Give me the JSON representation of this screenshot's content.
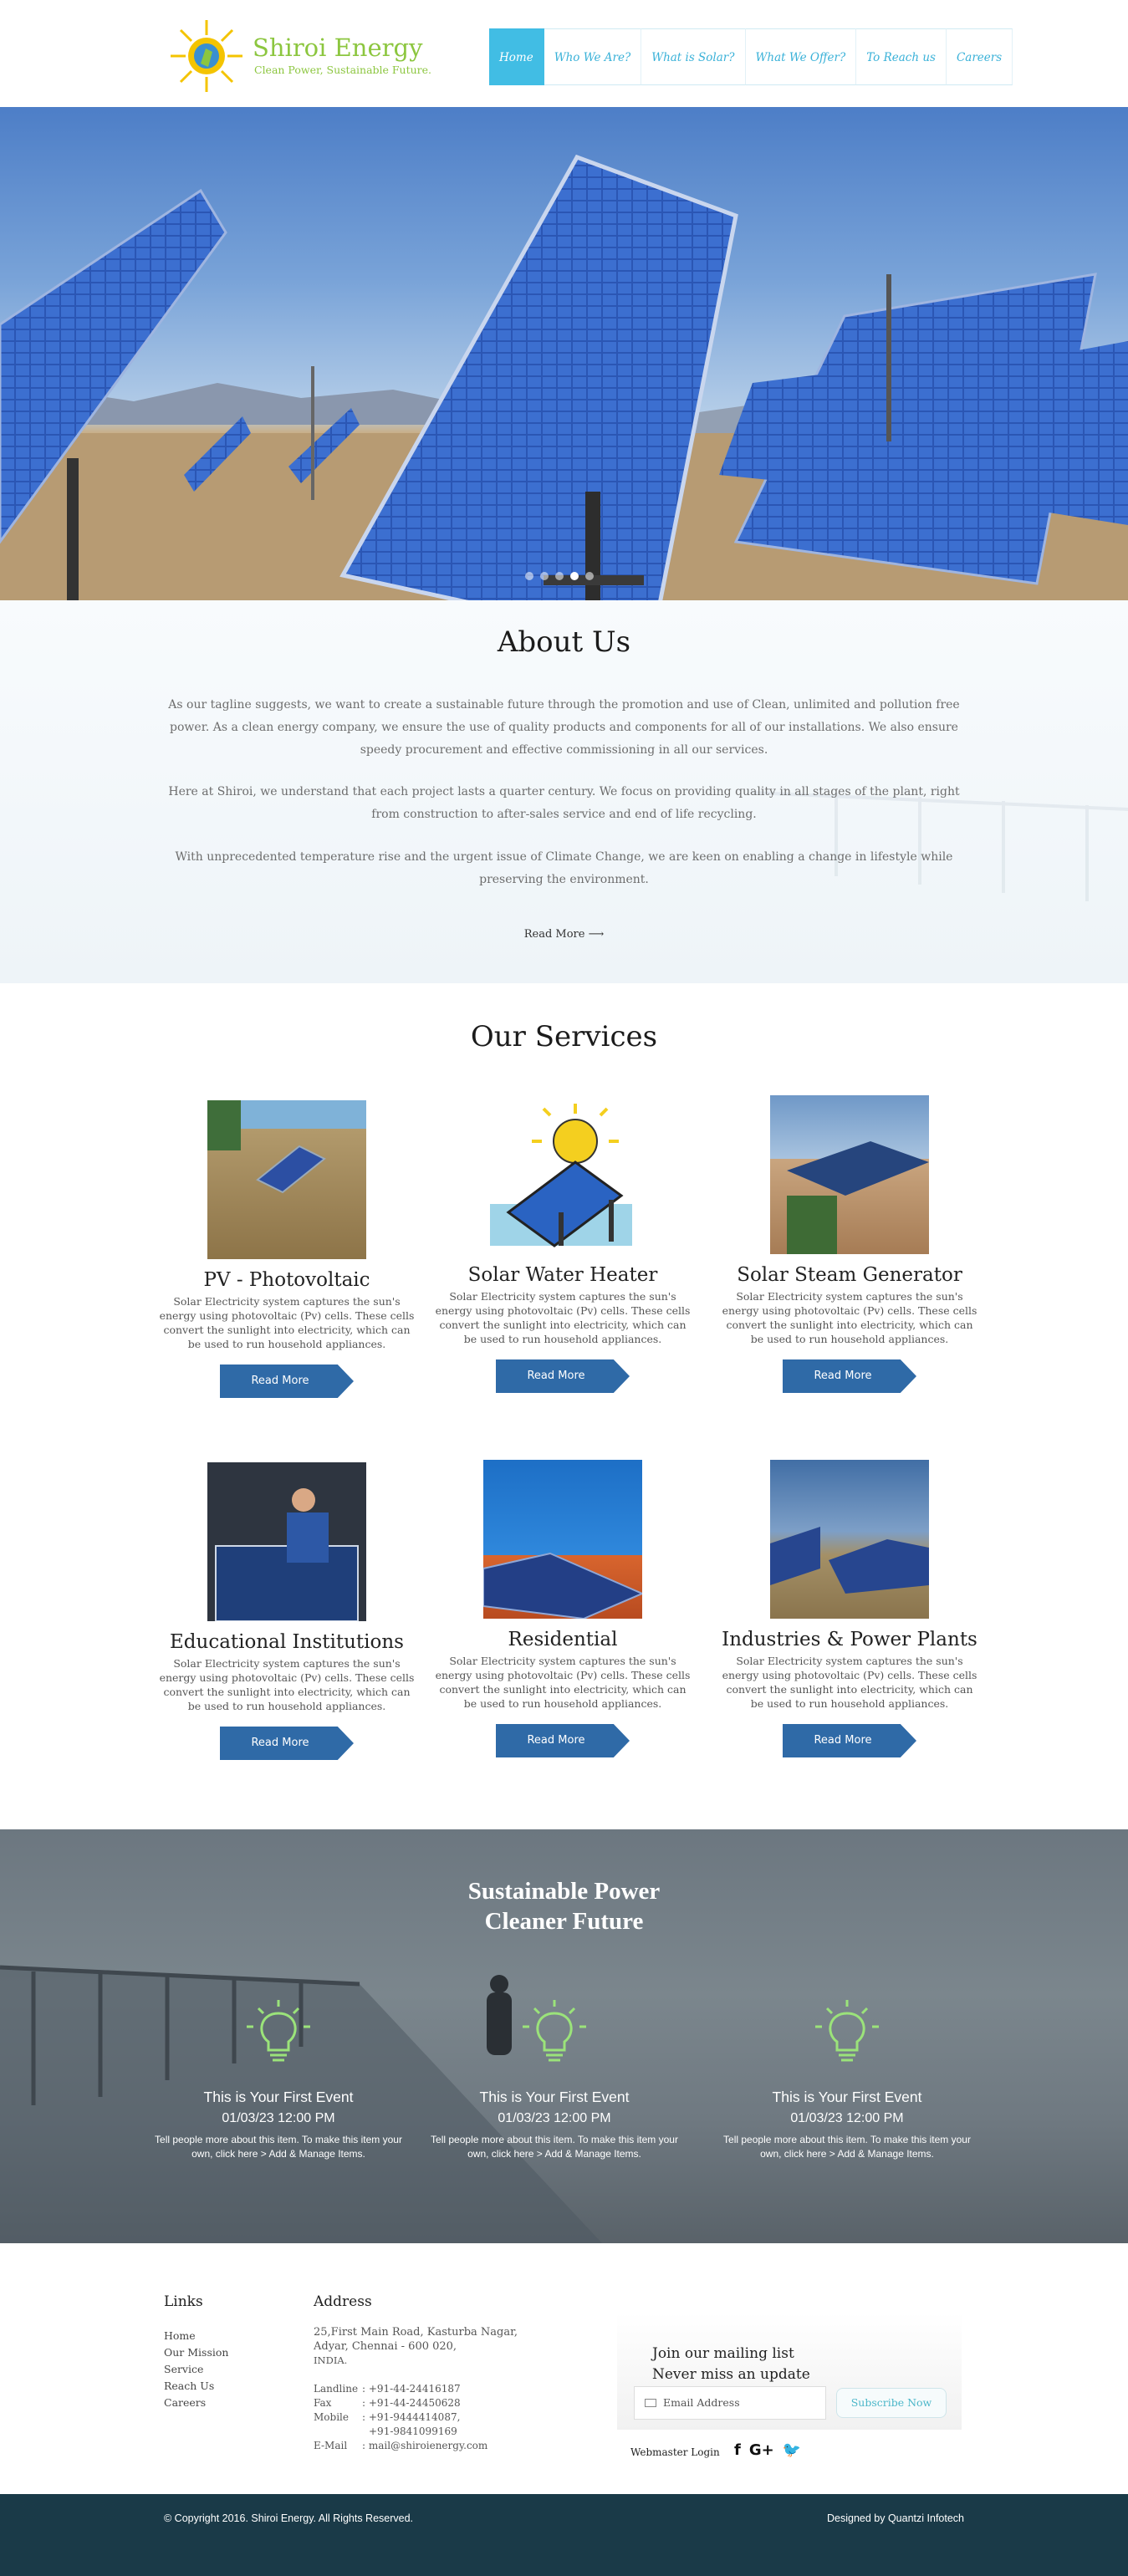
{
  "header": {
    "brand_name": "Shiroi Energy",
    "brand_tagline": "Clean Power, Sustainable Future.",
    "nav": [
      "Home",
      "Who We Are?",
      "What is Solar?",
      "What We Offer?",
      "To Reach us",
      "Careers"
    ],
    "active_nav": "Home",
    "accent_color": "#41bde4",
    "brand_color": "#8cc63f"
  },
  "hero": {
    "slides_count": 5,
    "active_slide": 4
  },
  "about": {
    "title": "About Us",
    "paragraphs": [
      "As our tagline suggests, we want to create a sustainable future through the promotion and use of Clean, unlimited and pollution free power. As a clean energy company, we ensure the use of quality products and  components for all of our installations. We also ensure speedy procurement and effective commissioning in all our services.",
      "Here at Shiroi, we understand that each project lasts a quarter century. We focus on providing quality in all stages of the plant, right from construction to after-sales service and end of life recycling.",
      "With unprecedented temperature rise and the urgent issue of Climate Change, we are keen on enabling a change in lifestyle while preserving the environment."
    ],
    "read_more": "Read More"
  },
  "services": {
    "title": "Our Services",
    "items": [
      {
        "title": "PV - Photovoltaic",
        "desc": "Solar Electricity system captures the sun's energy using photovoltaic (Pv) cells. These cells convert the sunlight into electricity, which can be used to run household appliances.",
        "button": "Read More",
        "icon": "thatched-roof-solar-image"
      },
      {
        "title": "Solar Water Heater",
        "desc": "Solar Electricity system captures the sun's energy using photovoltaic (Pv) cells. These cells convert the sunlight into electricity, which can be used to run household appliances.",
        "button": "Read More",
        "icon": "sun-panel-illustration"
      },
      {
        "title": "Solar Steam Generator",
        "desc": "Solar Electricity system captures the sun's energy using photovoltaic (Pv) cells. These cells convert the sunlight into electricity, which can be used to run household appliances.",
        "button": "Read More",
        "icon": "house-roof-solar-image"
      },
      {
        "title": "Educational Institutions",
        "desc": "Solar Electricity system captures the sun's energy using photovoltaic (Pv) cells. These cells convert the sunlight into electricity, which can be used to run household appliances.",
        "button": "Read More",
        "icon": "student-solar-panel-image"
      },
      {
        "title": "Residential",
        "desc": "Solar Electricity system captures the sun's energy using photovoltaic (Pv) cells. These cells convert the sunlight into electricity, which can be used to run household appliances.",
        "button": "Read More",
        "icon": "rooftop-panels-image"
      },
      {
        "title": "Industries & Power Plants",
        "desc": "Solar Electricity system captures the sun's energy using photovoltaic (Pv) cells. These cells convert the sunlight into electricity, which can be used to run household appliances.",
        "button": "Read More",
        "icon": "solar-farm-image"
      }
    ]
  },
  "events": {
    "title_line1": "Sustainable Power",
    "title_line2": "Cleaner Future",
    "items": [
      {
        "title": "This is Your First Event",
        "date": "01/03/23   12:00 PM",
        "desc": "Tell people more about this item. To make this item your own, click here > Add & Manage Items."
      },
      {
        "title": "This is Your First Event",
        "date": "01/03/23   12:00 PM",
        "desc": "Tell people more about this item. To make this item your own, click here > Add & Manage Items."
      },
      {
        "title": "This is Your First Event",
        "date": "01/03/23   12:00 PM",
        "desc": "Tell people more about this item. To make this item your own, click here > Add & Manage Items."
      }
    ],
    "bulb_color": "#9be37a"
  },
  "footer": {
    "links_title": "Links",
    "links": [
      "Home",
      "Our Mission",
      "Service",
      "Reach Us",
      "Careers"
    ],
    "address_title": "Address",
    "address_lines": [
      "25,First Main Road, Kasturba Nagar,",
      "Adyar, Chennai - 600 020,",
      "INDIA."
    ],
    "contacts": [
      {
        "label": "Landline",
        "value": ": +91-44-24416187"
      },
      {
        "label": "Fax",
        "value": ": +91-44-24450628"
      },
      {
        "label": "Mobile",
        "value": ": +91-9444414087,"
      },
      {
        "label": "",
        "value": "+91-9841099169"
      },
      {
        "label": "E-Mail",
        "value": ": mail@shiroienergy.com"
      }
    ],
    "mailing_line1": "Join our mailing list",
    "mailing_line2": "Never miss an update",
    "email_placeholder": "Email Address",
    "subscribe": "Subscribe Now",
    "webmaster": "Webmaster Login",
    "social": [
      "f",
      "G+",
      "🐦"
    ],
    "copyright": "© Copyright 2016.  Shiroi Energy. All Rights Reserved.",
    "designed_by": "Designed by Quantzi Infotech",
    "bottom_color": "#1a3a48"
  }
}
